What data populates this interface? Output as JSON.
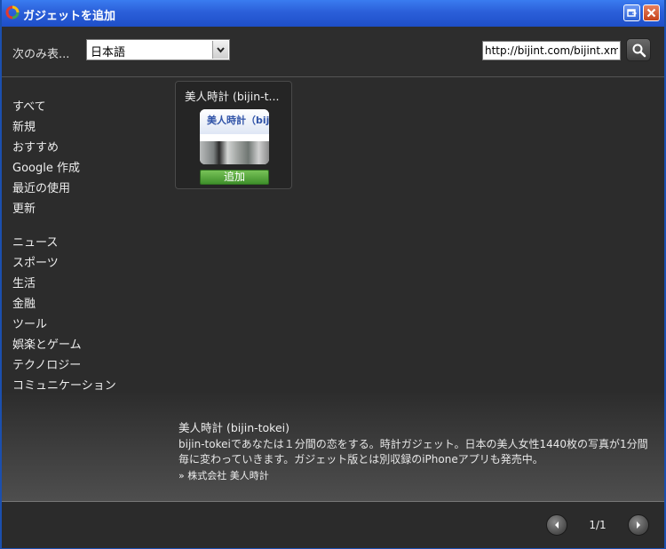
{
  "window": {
    "title": "ガジェットを追加"
  },
  "toolbar": {
    "filter_label": "次のみ表...",
    "language_selected": "日本語",
    "url_value": "http://bijint.com/bijint.xml"
  },
  "sidebar": {
    "group1": [
      {
        "label": "すべて"
      },
      {
        "label": "新規"
      },
      {
        "label": "おすすめ"
      },
      {
        "label": "Google 作成"
      },
      {
        "label": "最近の使用"
      },
      {
        "label": "更新"
      }
    ],
    "group2": [
      {
        "label": "ニュース"
      },
      {
        "label": "スポーツ"
      },
      {
        "label": "生活"
      },
      {
        "label": "金融"
      },
      {
        "label": "ツール"
      },
      {
        "label": "娯楽とゲーム"
      },
      {
        "label": "テクノロジー"
      },
      {
        "label": "コミュニケーション"
      }
    ]
  },
  "gadget": {
    "card_title": "美人時計 (bijin-t...",
    "thumb_text": "美人時計（bij",
    "add_label": "追加"
  },
  "detail": {
    "title": "美人時計 (bijin-tokei)",
    "description": "bijin-tokeiであなたは１分間の恋をする。時計ガジェット。日本の美人女性1440枚の写真が1分間毎に変わっていきます。ガジェット版とは別収録のiPhoneアプリも発売中。",
    "author": "» 株式会社 美人時計"
  },
  "pagination": {
    "text": "1/1"
  },
  "colors": {
    "titlebar": "#2b5fd9",
    "add_button": "#4fa533",
    "background": "#2c2c2c"
  }
}
